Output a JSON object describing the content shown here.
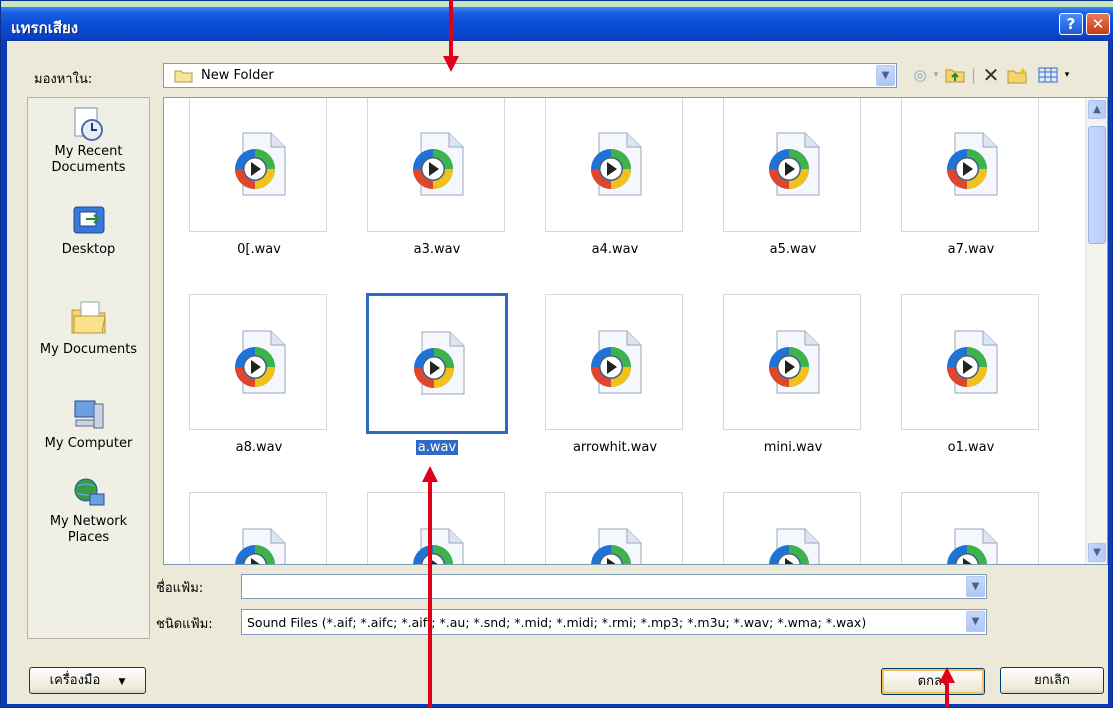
{
  "window": {
    "title": "แทรกเสียง",
    "help_glyph": "?",
    "close_glyph": "✕"
  },
  "look_in": {
    "label": "มองหาใน:",
    "value": "New Folder"
  },
  "places": [
    {
      "label": "My Recent Documents",
      "icon": "recent-documents-icon"
    },
    {
      "label": "Desktop",
      "icon": "desktop-icon"
    },
    {
      "label": "My Documents",
      "icon": "my-documents-icon"
    },
    {
      "label": "My Computer",
      "icon": "my-computer-icon"
    },
    {
      "label": "My Network Places",
      "icon": "network-places-icon"
    }
  ],
  "files": [
    {
      "name": "0[.wav"
    },
    {
      "name": "a3.wav"
    },
    {
      "name": "a4.wav"
    },
    {
      "name": "a5.wav"
    },
    {
      "name": "a7.wav"
    },
    {
      "name": "a8.wav"
    },
    {
      "name": "a.wav",
      "selected": true
    },
    {
      "name": "arrowhit.wav"
    },
    {
      "name": "mini.wav"
    },
    {
      "name": "o1.wav"
    },
    {
      "name": ""
    },
    {
      "name": ""
    },
    {
      "name": ""
    },
    {
      "name": ""
    },
    {
      "name": ""
    }
  ],
  "file_name": {
    "label": "ชื่อแฟ้ม:",
    "value": ""
  },
  "file_type": {
    "label": "ชนิดแฟ้ม:",
    "value": "Sound Files (*.aif; *.aifc; *.aiff; *.au; *.snd; *.mid; *.midi; *.rmi; *.mp3; *.m3u; *.wav; *.wma; *.wax)"
  },
  "buttons": {
    "tools": "เครื่องมือ",
    "ok": "ตกลง",
    "cancel": "ยกเลิก"
  },
  "colors": {
    "titlebar": "#0a4cd6",
    "selection": "#316ac5",
    "annotation_arrow": "#e0001a"
  }
}
